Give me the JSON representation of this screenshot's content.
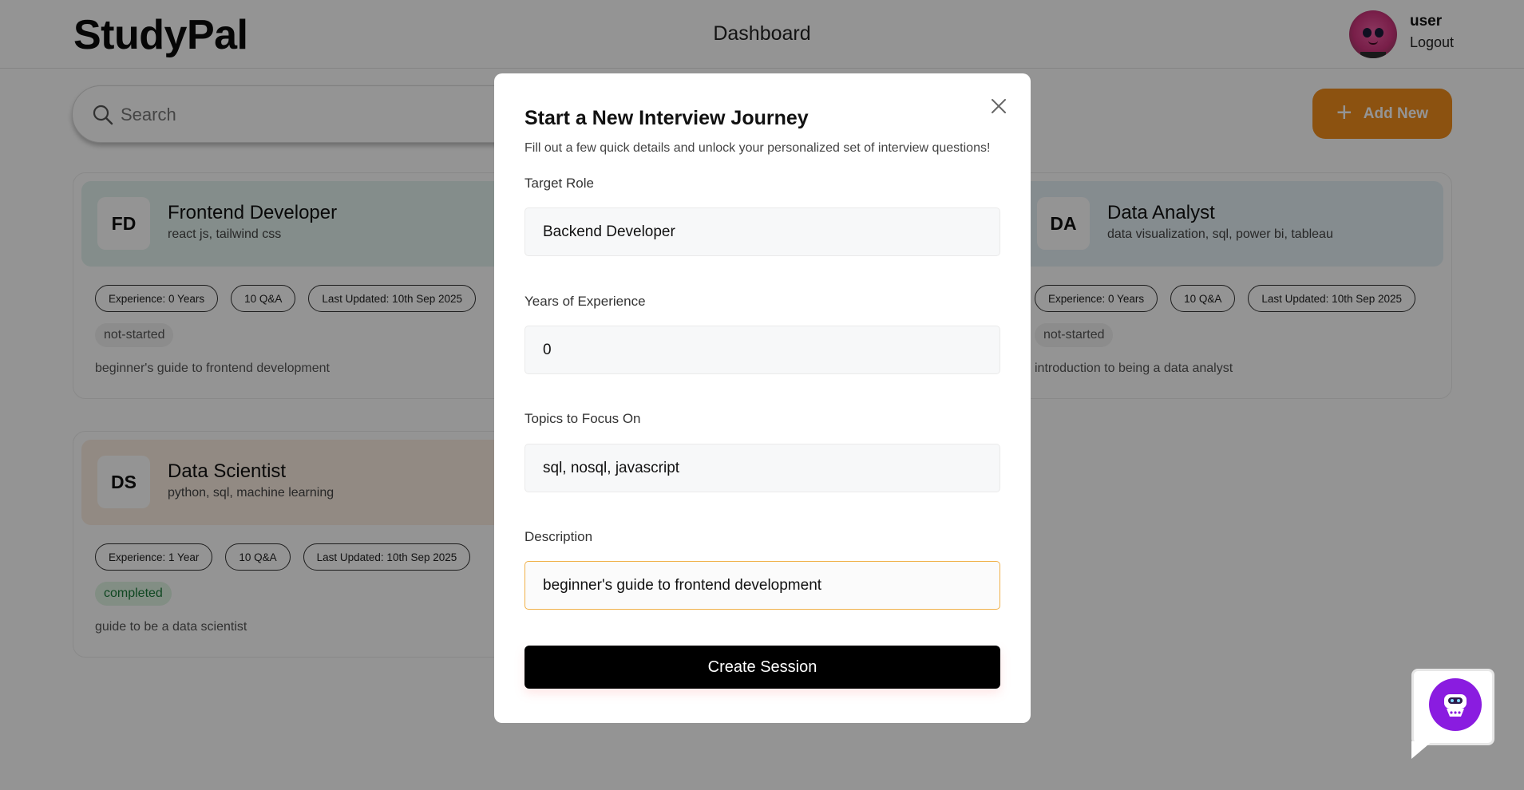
{
  "header": {
    "logo": "StudyPal",
    "nav_title": "Dashboard",
    "user_name": "user",
    "logout_label": "Logout"
  },
  "search": {
    "placeholder": "Search",
    "value": ""
  },
  "add_button": {
    "label": "Add New"
  },
  "cards": [
    {
      "initials": "FD",
      "title": "Frontend Developer",
      "skills": "react js, tailwind css",
      "experience": "Experience: 0 Years",
      "qa": "10 Q&A",
      "updated": "Last Updated: 10th Sep 2025",
      "status": "not-started",
      "description": "beginner's guide to frontend development",
      "color": "#e3f3ef"
    },
    {
      "initials": "DA",
      "title": "Data Analyst",
      "skills": "data visualization, sql, power bi, tableau",
      "experience": "Experience: 0 Years",
      "qa": "10 Q&A",
      "updated": "Last Updated: 10th Sep 2025",
      "status": "not-started",
      "description": "introduction to being a data analyst",
      "color": "#e6f1f6"
    },
    {
      "initials": "DS",
      "title": "Data Scientist",
      "skills": "python, sql, machine learning",
      "experience": "Experience: 1 Year",
      "qa": "10 Q&A",
      "updated": "Last Updated: 10th Sep 2025",
      "status": "completed",
      "description": "guide to be a data scientist",
      "color": "#fbeee2"
    }
  ],
  "modal": {
    "title": "Start a New Interview Journey",
    "subtitle": "Fill out a few quick details and unlock your personalized set of interview questions!",
    "fields": {
      "target_role": {
        "label": "Target Role",
        "value": "Backend Developer"
      },
      "experience": {
        "label": "Years of Experience",
        "value": "0"
      },
      "topics": {
        "label": "Topics to Focus On",
        "value": "sql, nosql, javascript"
      },
      "description": {
        "label": "Description",
        "value": "beginner's guide to frontend development"
      }
    },
    "submit_label": "Create Session"
  },
  "colors": {
    "accent": "#f28d1c",
    "overlay": "rgba(0,0,0,0.42)",
    "chatbot": "#8a1ce0"
  },
  "icons": {
    "search": "search-icon",
    "add": "plus-icon",
    "close": "close-icon",
    "chatbot": "robot-icon"
  }
}
